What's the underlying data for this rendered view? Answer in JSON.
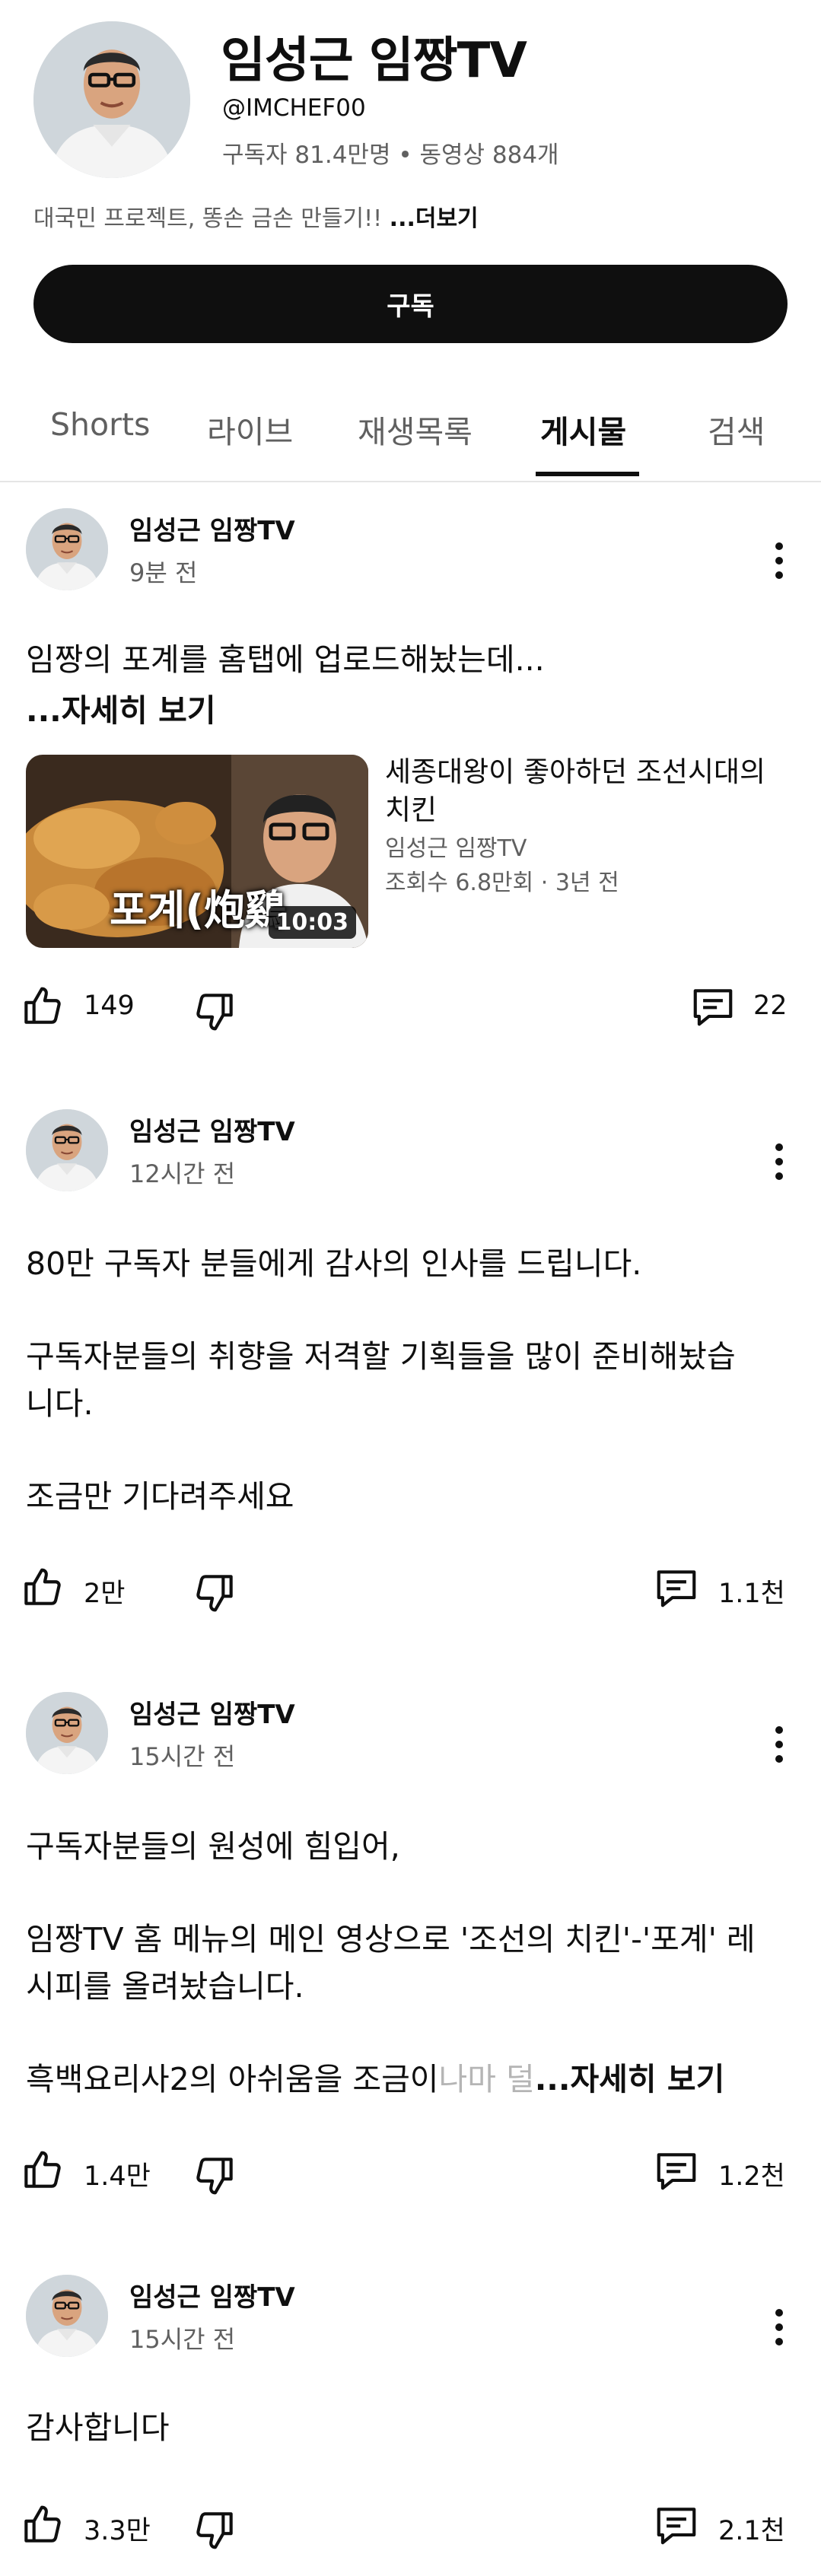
{
  "channel": {
    "name": "임성근 임짱TV",
    "handle": "@IMCHEF00",
    "stats": "구독자 81.4만명 • 동영상 884개",
    "description": "대국민 프로젝트, 똥손 금손 만들기!! ",
    "description_more": "...더보기",
    "subscribe_label": "구독"
  },
  "tabs": [
    {
      "label": "Shorts"
    },
    {
      "label": "라이브"
    },
    {
      "label": "재생목록"
    },
    {
      "label": "게시물"
    },
    {
      "label": "검색"
    }
  ],
  "posts": [
    {
      "author": "임성근 임짱TV",
      "time": "9분 전",
      "text_lines": [
        "임짱의 포계를 홈탭에 업로드해놨는데..."
      ],
      "more": "...자세히 보기",
      "video": {
        "title": "세종대왕이 좋아하던 조선시대의 치킨",
        "channel": "임성근 임짱TV",
        "meta": "조회수 6.8만회 · 3년 전",
        "duration": "10:03",
        "thumb_caption": "포계(炮鷄"
      },
      "likes": "149",
      "comments": "22"
    },
    {
      "author": "임성근 임짱TV",
      "time": "12시간 전",
      "text_lines": [
        "80만 구독자 분들에게 감사의 인사를 드립니다.",
        "",
        "구독자분들의 취향을 저격할 기획들을 많이 준비해놨습",
        "니다.",
        "",
        "조금만 기다려주세요"
      ],
      "likes": "2만",
      "comments": "1.1천"
    },
    {
      "author": "임성근 임짱TV",
      "time": "15시간 전",
      "text_lines": [
        "구독자분들의 원성에 힘입어,",
        "",
        "임짱TV 홈 메뉴의 메인 영상으로 '조선의 치킨'-'포계' 레",
        "시피를 올려놨습니다.",
        ""
      ],
      "last_line": "흑백요리사2의 아쉬움을 조금이",
      "last_line_fade": "나마 덜",
      "more": "...자세히 보기",
      "likes": "1.4만",
      "comments": "1.2천"
    },
    {
      "author": "임성근 임짱TV",
      "time": "15시간 전",
      "text_lines": [
        "감사합니다"
      ],
      "likes": "3.3만",
      "comments": "2.1천"
    }
  ],
  "icons": {
    "like": "thumbs-up-icon",
    "dislike": "thumbs-down-icon",
    "comment": "comment-icon",
    "more": "more-vert-icon"
  },
  "colors": {
    "primary_text": "#0f0f0f",
    "secondary_text": "#606060",
    "subscribe_bg": "#0f0f0f"
  }
}
